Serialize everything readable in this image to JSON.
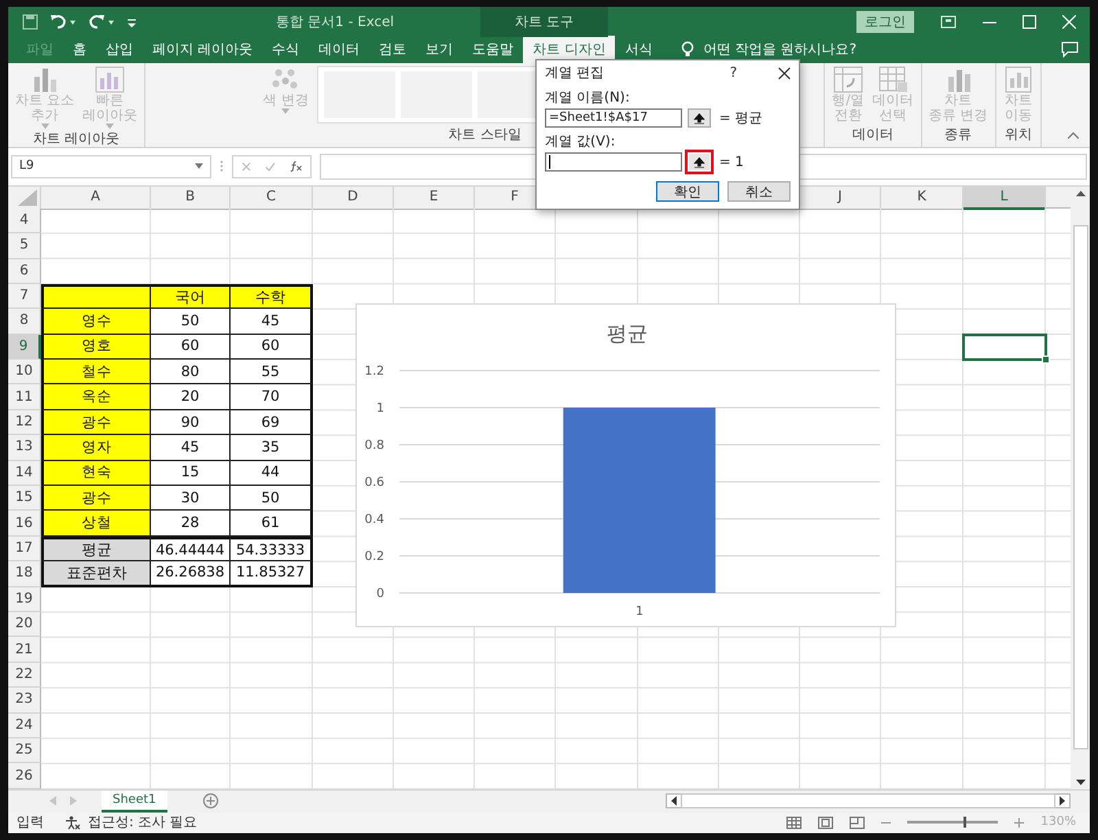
{
  "title_bar": {
    "title": "통합 문서1 - Excel",
    "context_tab": "차트 도구",
    "login": "로그인"
  },
  "tabs": [
    {
      "label": "파일",
      "selected": false,
      "disabled": true
    },
    {
      "label": "홈",
      "selected": false,
      "disabled": false
    },
    {
      "label": "삽입",
      "selected": false,
      "disabled": false
    },
    {
      "label": "페이지 레이아웃",
      "selected": false,
      "disabled": false
    },
    {
      "label": "수식",
      "selected": false,
      "disabled": false
    },
    {
      "label": "데이터",
      "selected": false,
      "disabled": false
    },
    {
      "label": "검토",
      "selected": false,
      "disabled": false
    },
    {
      "label": "보기",
      "selected": false,
      "disabled": false
    },
    {
      "label": "도움말",
      "selected": false,
      "disabled": false
    },
    {
      "label": "차트 디자인",
      "selected": true,
      "disabled": false
    },
    {
      "label": "서식",
      "selected": false,
      "disabled": false
    }
  ],
  "tell_me": "어떤 작업을 원하시나요?",
  "ribbon": {
    "groups": [
      {
        "label": "차트 레이아웃",
        "buttons": [
          {
            "lines": [
              "차트 요소",
              "추가"
            ],
            "dropdown": true,
            "disabled": true
          },
          {
            "lines": [
              "빠른",
              "레이아웃"
            ],
            "dropdown": true,
            "disabled": true
          }
        ]
      },
      {
        "label": "차트 스타일",
        "buttons": [
          {
            "lines": [
              "색 변경"
            ],
            "dropdown": true,
            "disabled": true
          }
        ],
        "gallery": true
      },
      {
        "label": "데이터",
        "buttons": [
          {
            "lines": [
              "행/열",
              "전환"
            ],
            "dropdown": false,
            "disabled": true
          },
          {
            "lines": [
              "데이터",
              "선택"
            ],
            "dropdown": false,
            "disabled": true
          }
        ]
      },
      {
        "label": "종류",
        "buttons": [
          {
            "lines": [
              "차트",
              "종류 변경"
            ],
            "dropdown": false,
            "disabled": true
          }
        ]
      },
      {
        "label": "위치",
        "buttons": [
          {
            "lines": [
              "차트",
              "이동"
            ],
            "dropdown": false,
            "disabled": true
          }
        ]
      }
    ]
  },
  "formula_bar": {
    "name_box": "L9"
  },
  "sheet": {
    "columns": [
      {
        "label": "A",
        "selected": false
      },
      {
        "label": "B",
        "selected": false
      },
      {
        "label": "C",
        "selected": false
      },
      {
        "label": "D",
        "selected": false
      },
      {
        "label": "E",
        "selected": false
      },
      {
        "label": "F",
        "selected": false
      },
      {
        "label": "J",
        "selected": false
      },
      {
        "label": "K",
        "selected": false
      },
      {
        "label": "L",
        "selected": true
      }
    ],
    "rows": [
      {
        "label": "4",
        "selected": false
      },
      {
        "label": "5",
        "selected": false
      },
      {
        "label": "6",
        "selected": false
      },
      {
        "label": "7",
        "selected": false,
        "kind": "header",
        "cells": [
          "국어",
          "수학"
        ]
      },
      {
        "label": "8",
        "selected": false,
        "kind": "data",
        "cells": [
          "영수",
          "50",
          "45"
        ]
      },
      {
        "label": "9",
        "selected": true,
        "kind": "data",
        "cells": [
          "영호",
          "60",
          "60"
        ]
      },
      {
        "label": "10",
        "selected": false,
        "kind": "data",
        "cells": [
          "철수",
          "80",
          "55"
        ]
      },
      {
        "label": "11",
        "selected": false,
        "kind": "data",
        "cells": [
          "옥순",
          "20",
          "70"
        ]
      },
      {
        "label": "12",
        "selected": false,
        "kind": "data",
        "cells": [
          "광수",
          "90",
          "69"
        ]
      },
      {
        "label": "13",
        "selected": false,
        "kind": "data",
        "cells": [
          "영자",
          "45",
          "35"
        ]
      },
      {
        "label": "14",
        "selected": false,
        "kind": "data",
        "cells": [
          "현숙",
          "15",
          "44"
        ]
      },
      {
        "label": "15",
        "selected": false,
        "kind": "data",
        "cells": [
          "광수",
          "30",
          "50"
        ]
      },
      {
        "label": "16",
        "selected": false,
        "kind": "data",
        "cells": [
          "상철",
          "28",
          "61"
        ]
      },
      {
        "label": "17",
        "selected": false,
        "kind": "summary",
        "cells": [
          "평균",
          "46.44444",
          "54.33333"
        ]
      },
      {
        "label": "18",
        "selected": false,
        "kind": "summary",
        "cells": [
          "표준편차",
          "26.26838",
          "11.85327"
        ]
      },
      {
        "label": "19",
        "selected": false
      },
      {
        "label": "20",
        "selected": false
      },
      {
        "label": "21",
        "selected": false
      },
      {
        "label": "22",
        "selected": false
      },
      {
        "label": "23",
        "selected": false
      },
      {
        "label": "24",
        "selected": false
      },
      {
        "label": "25",
        "selected": false
      },
      {
        "label": "26",
        "selected": false
      }
    ]
  },
  "chart": {
    "chart_data": {
      "type": "bar",
      "title": "평균",
      "categories": [
        "1"
      ],
      "values": [
        1
      ],
      "ylim": [
        0,
        1.2
      ],
      "yticks": [
        0,
        0.2,
        0.4,
        0.6,
        0.8,
        1,
        1.2
      ],
      "grid": true
    }
  },
  "dialog": {
    "title": "계열 편집",
    "help": "?",
    "fields": [
      {
        "label": "계열 이름(N):",
        "value": "=Sheet1!$A$17",
        "result": "= 평균",
        "highlighted": false,
        "focused": false
      },
      {
        "label": "계열 값(V):",
        "result": "= 1",
        "highlighted": true,
        "focused": true
      }
    ],
    "buttons": [
      {
        "label": "확인",
        "default": true
      },
      {
        "label": "취소",
        "default": false
      }
    ]
  },
  "sheet_tabs": [
    {
      "label": "Sheet1",
      "selected": true
    }
  ],
  "status_bar": {
    "mode": "입력",
    "accessibility": "접근성: 조사 필요",
    "zoom": "130%",
    "zoom_slider": {
      "level": 0.62
    }
  }
}
